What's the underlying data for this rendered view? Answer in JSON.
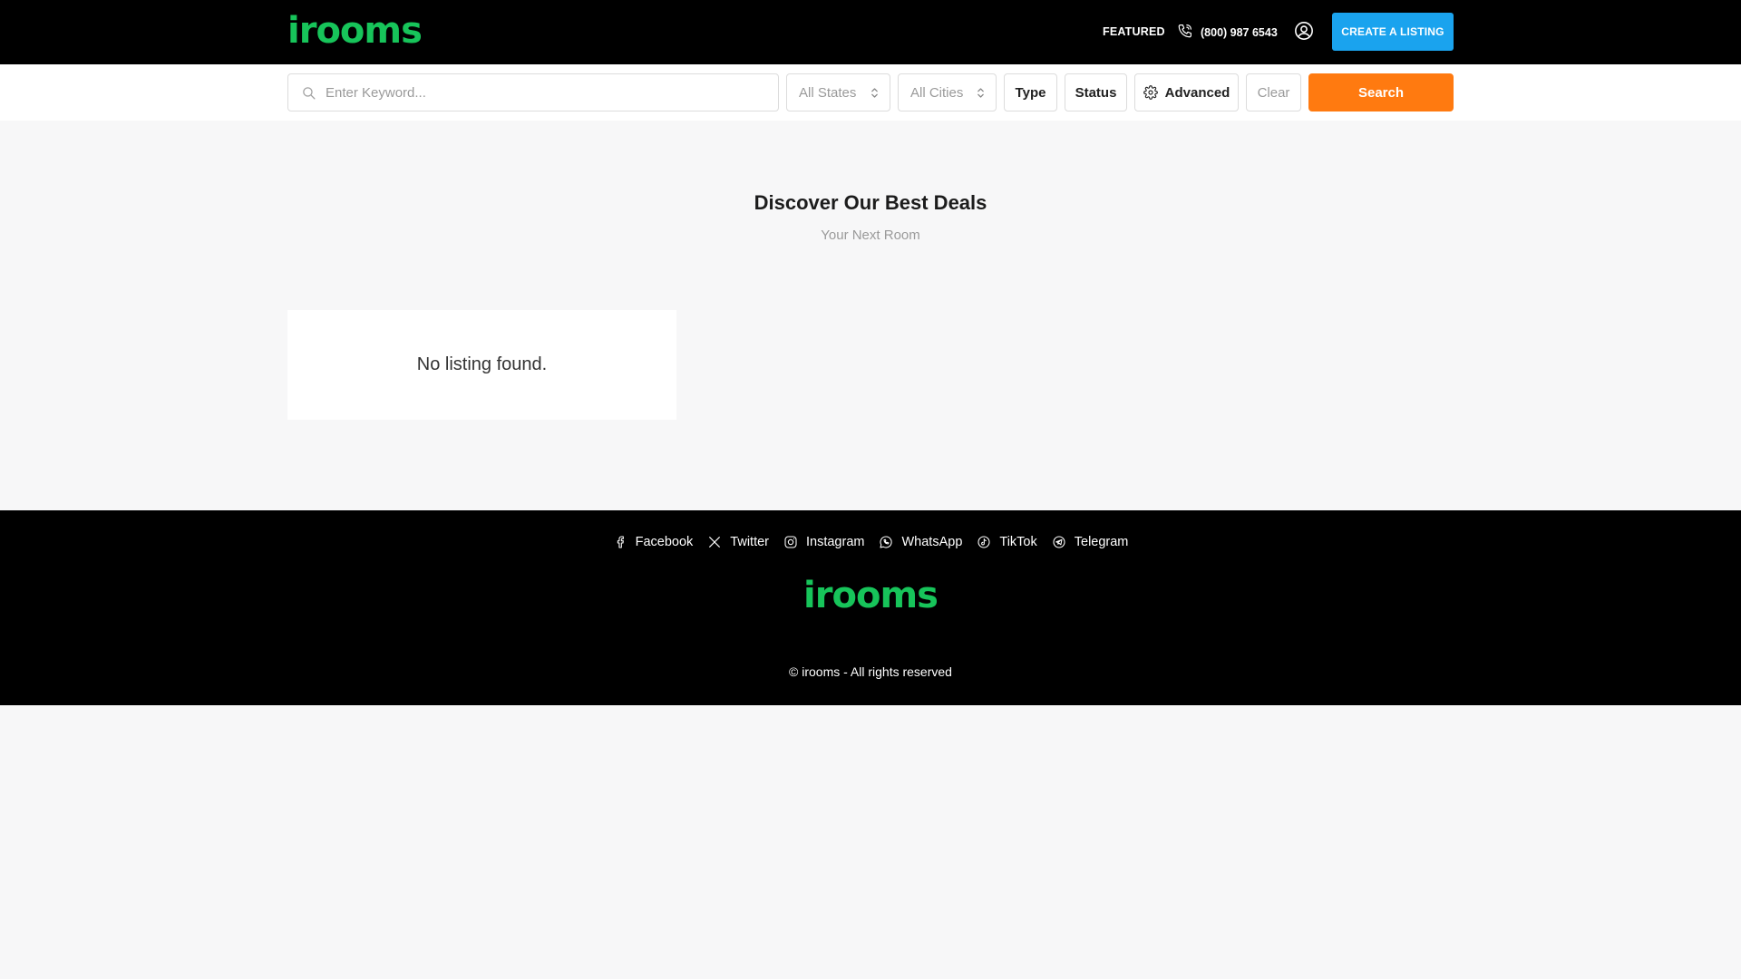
{
  "header": {
    "logo": "irooms",
    "nav_featured": "FEATURED",
    "phone": "(800) 987 6543",
    "create_button": "CREATE A LISTING"
  },
  "search": {
    "keyword_placeholder": "Enter Keyword...",
    "states_value": "All States",
    "cities_value": "All Cities",
    "type_label": "Type",
    "status_label": "Status",
    "advanced_label": "Advanced",
    "clear_label": "Clear",
    "search_label": "Search"
  },
  "main": {
    "title": "Discover Our Best Deals",
    "subtitle": "Your Next Room",
    "empty_message": "No listing found."
  },
  "footer": {
    "socials": [
      {
        "label": "Facebook",
        "icon": "facebook-icon"
      },
      {
        "label": "Twitter",
        "icon": "x-twitter-icon"
      },
      {
        "label": "Instagram",
        "icon": "instagram-icon"
      },
      {
        "label": "WhatsApp",
        "icon": "whatsapp-icon"
      },
      {
        "label": "TikTok",
        "icon": "tiktok-icon"
      },
      {
        "label": "Telegram",
        "icon": "telegram-icon"
      }
    ],
    "logo": "irooms",
    "copyright": "© irooms - All rights reserved"
  },
  "colors": {
    "brand_green": "#17c45a",
    "create_blue": "#1aa3ee",
    "search_orange": "#ff7a10"
  }
}
